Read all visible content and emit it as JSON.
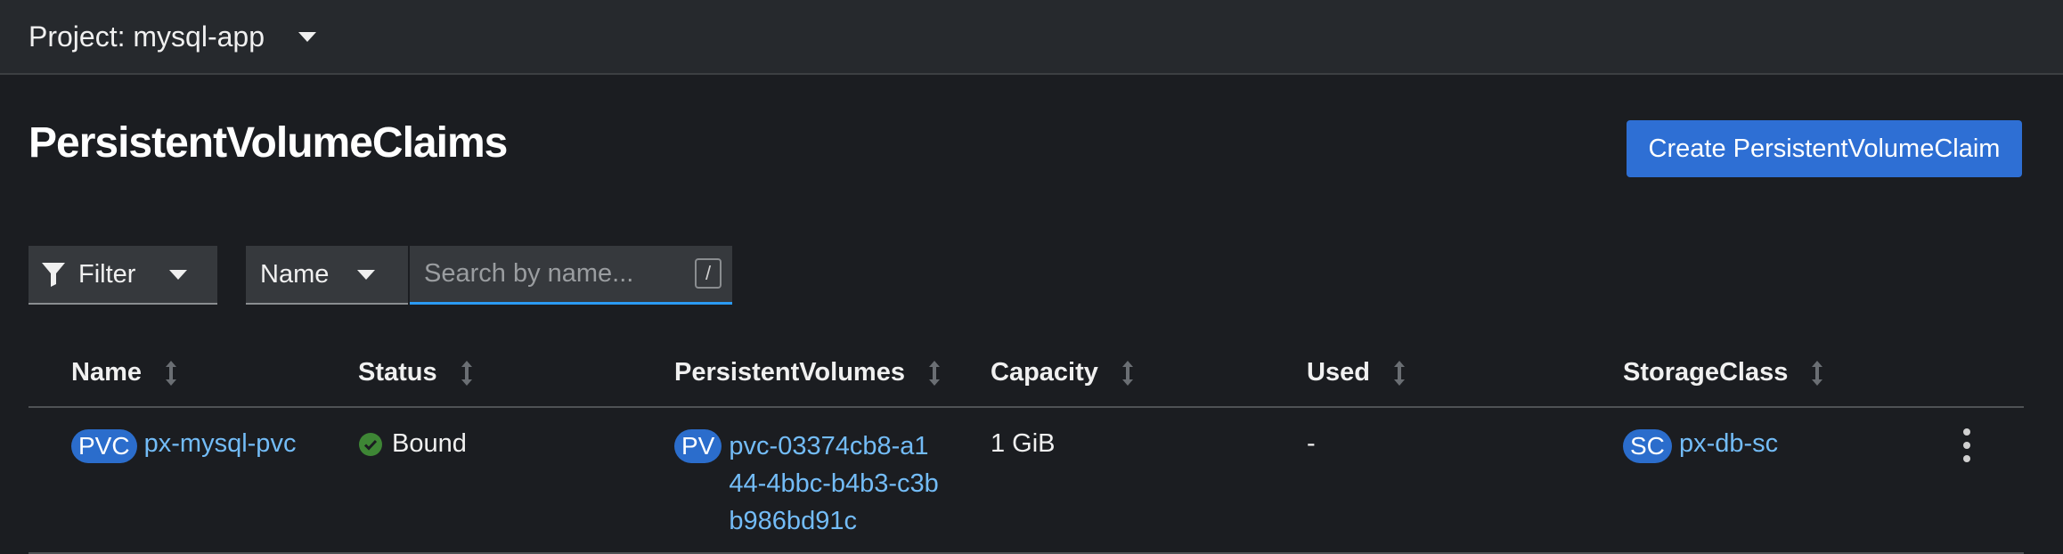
{
  "topbar": {
    "project_label": "Project: mysql-app"
  },
  "page": {
    "title": "PersistentVolumeClaims",
    "create_button": "Create PersistentVolumeClaim"
  },
  "toolbar": {
    "filter_label": "Filter",
    "name_select": "Name",
    "search_placeholder": "Search by name...",
    "search_shortcut": "/"
  },
  "table": {
    "columns": [
      "Name",
      "Status",
      "PersistentVolumes",
      "Capacity",
      "Used",
      "StorageClass"
    ],
    "rows": [
      {
        "name_badge": "PVC",
        "name": "px-mysql-pvc",
        "status": "Bound",
        "pv_badge": "PV",
        "persistent_volume": "pvc-03374cb8-a144-4bbc-b4b3-c3bb986bd91c",
        "capacity": "1 GiB",
        "used": "-",
        "sc_badge": "SC",
        "storage_class": "px-db-sc"
      }
    ]
  },
  "colors": {
    "background": "#1b1d21",
    "accent_button": "#2e6fd4",
    "link": "#73bcf7",
    "badge": "#2b6dcc",
    "status_ok": "#3e8635"
  }
}
